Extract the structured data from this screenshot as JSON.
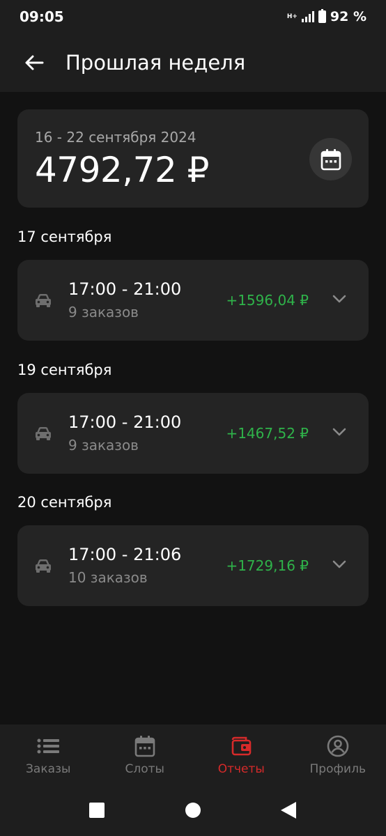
{
  "status_bar": {
    "time": "09:05",
    "network": "H+",
    "battery": "92 %"
  },
  "app_bar": {
    "title": "Прошлая неделя",
    "back_icon": "arrow-left-icon"
  },
  "summary": {
    "period": "16 - 22 сентября 2024",
    "total": "4792,72 ₽",
    "calendar_icon": "calendar-icon"
  },
  "days": [
    {
      "date": "17 сентября",
      "slots": [
        {
          "time": "17:00 - 21:00",
          "orders": "9 заказов",
          "amount": "+1596,04 ₽"
        }
      ]
    },
    {
      "date": "19 сентября",
      "slots": [
        {
          "time": "17:00 - 21:00",
          "orders": "9 заказов",
          "amount": "+1467,52 ₽"
        }
      ]
    },
    {
      "date": "20 сентября",
      "slots": [
        {
          "time": "17:00 - 21:06",
          "orders": "10 заказов",
          "amount": "+1729,16 ₽"
        }
      ]
    }
  ],
  "bottom_nav": {
    "items": [
      {
        "label": "Заказы",
        "icon": "list-icon",
        "active": false
      },
      {
        "label": "Слоты",
        "icon": "calendar-icon",
        "active": false
      },
      {
        "label": "Отчеты",
        "icon": "wallet-icon",
        "active": true
      },
      {
        "label": "Профиль",
        "icon": "profile-icon",
        "active": false
      }
    ]
  },
  "colors": {
    "background": "#121212",
    "card": "#242424",
    "positive_amount": "#2fb34a",
    "active_nav": "#d62a2a",
    "inactive_nav": "#7a7a7a"
  }
}
